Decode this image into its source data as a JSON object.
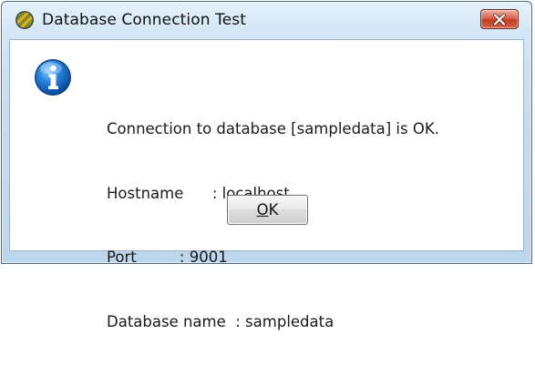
{
  "window": {
    "title": "Database Connection Test",
    "app_icon": "striped-circle-icon",
    "close_icon": "close-x-icon"
  },
  "dialog": {
    "icon": "info-icon",
    "message_lines": [
      "Connection to database [sampledata] is OK.",
      "Hostname      : localhost",
      "Port         : 9001",
      "Database name  : sampledata"
    ],
    "ok_button": {
      "mnemonic": "O",
      "rest": "K"
    }
  },
  "colors": {
    "title_bar": "#c4dcef",
    "close_button": "#c9432a",
    "info_icon": "#1b6fc4"
  }
}
